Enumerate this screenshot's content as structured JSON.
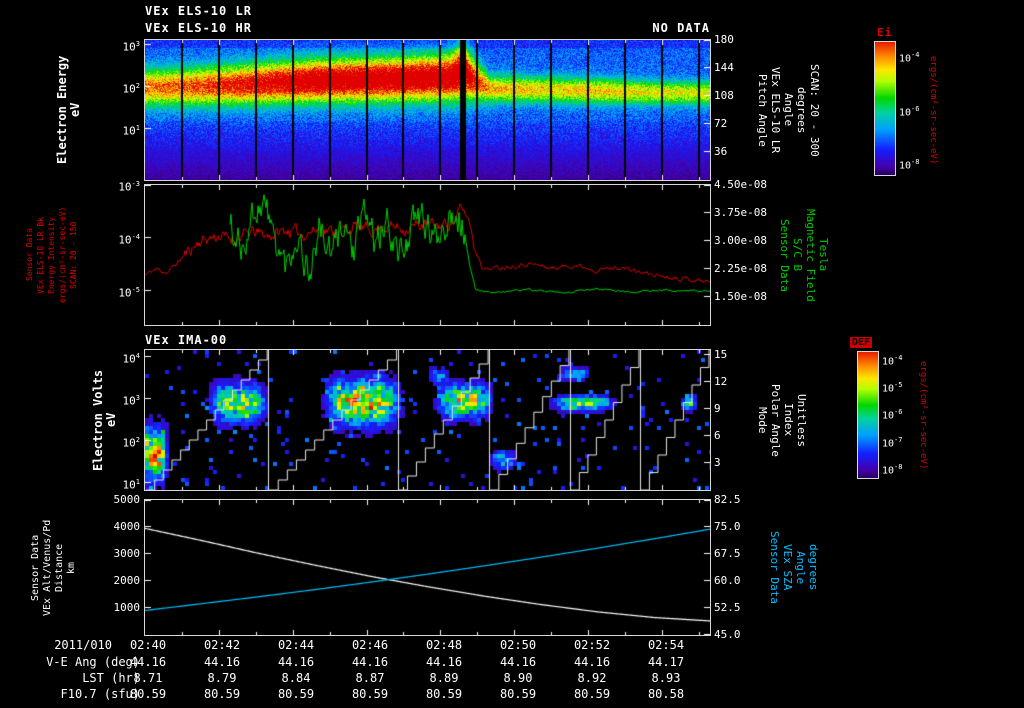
{
  "header": {
    "title1": "VEx ELS-10 LR",
    "title2": "VEx ELS-10 HR",
    "no_data": "NO DATA",
    "ima_title": "VEx IMA-00"
  },
  "colors": {
    "red": "#dd0000",
    "green": "#00cc00",
    "cyan": "#00bfff",
    "white": "#ffffff"
  },
  "colorbar1": {
    "title": "Ei",
    "units": "ergs/(cm²-sr-sec-eV)",
    "ticks": [
      "10^-4",
      "10^-6",
      "10^-8"
    ],
    "tick_fracs": [
      0.1,
      0.5,
      0.9
    ]
  },
  "colorbar2": {
    "title": "DEF",
    "units": "ergs/(cm²-sr-sec-eV)",
    "ticks": [
      "10^-4",
      "10^-5",
      "10^-6",
      "10^-7",
      "10^-8"
    ],
    "tick_fracs": [
      0.05,
      0.265,
      0.48,
      0.695,
      0.91
    ]
  },
  "footer": {
    "date": "2011/010",
    "time_ticks": [
      "02:40",
      "02:42",
      "02:44",
      "02:46",
      "02:48",
      "02:50",
      "02:52",
      "02:54"
    ],
    "rows": [
      {
        "label": "V-E Ang (deg)",
        "values": [
          "44.16",
          "44.16",
          "44.16",
          "44.16",
          "44.16",
          "44.16",
          "44.16",
          "44.17"
        ]
      },
      {
        "label": "LST (hr)",
        "values": [
          "8.71",
          "8.79",
          "8.84",
          "8.87",
          "8.89",
          "8.90",
          "8.92",
          "8.93"
        ]
      },
      {
        "label": "F10.7 (sfu)",
        "values": [
          "80.59",
          "80.59",
          "80.59",
          "80.59",
          "80.59",
          "80.59",
          "80.59",
          "80.58"
        ]
      }
    ]
  },
  "chart_data": [
    {
      "type": "heatmap",
      "title": "VEx ELS-10 LR",
      "subtitle": "VEx ELS-10 HR: NO DATA",
      "ylabel_lines": [
        "Electron Energy",
        "eV"
      ],
      "right_label_lines": [
        "Pitch Angle",
        "VEx ELS-10 LR",
        "Angle",
        "degrees",
        "SCAN: 20 - 300"
      ],
      "y_axis": {
        "scale": "log",
        "units": "eV",
        "log_range": [
          -0.21,
          3.12
        ],
        "ticks": [
          {
            "log": 3,
            "label": "10^3"
          },
          {
            "log": 2,
            "label": "10^2"
          },
          {
            "log": 1,
            "label": "10^1"
          }
        ]
      },
      "right_axis": {
        "units": "degrees",
        "range": [
          0,
          180
        ],
        "ticks": [
          180,
          144,
          108,
          72,
          36
        ]
      },
      "x_axis": {
        "date": "2011/010",
        "start": "02:40",
        "end": "02:55",
        "tick_interval_min": 2,
        "total_min": 15.3
      },
      "colorbar_label": "Ei",
      "band_track_format": [
        "time_frac",
        "log10_center_eV",
        "log10_width",
        "intensity"
      ],
      "band_track": [
        [
          0.0,
          2.0,
          0.42,
          0.68
        ],
        [
          0.08,
          2.02,
          0.44,
          0.72
        ],
        [
          0.18,
          2.08,
          0.46,
          0.85
        ],
        [
          0.3,
          2.16,
          0.48,
          1.0
        ],
        [
          0.45,
          2.2,
          0.5,
          1.0
        ],
        [
          0.54,
          2.24,
          0.52,
          1.0
        ],
        [
          0.562,
          2.38,
          0.62,
          1.05
        ],
        [
          0.585,
          2.15,
          0.45,
          0.8
        ],
        [
          0.61,
          1.97,
          0.32,
          0.6
        ],
        [
          0.7,
          1.95,
          0.3,
          0.56
        ],
        [
          0.8,
          1.92,
          0.3,
          0.58
        ],
        [
          0.9,
          1.88,
          0.28,
          0.52
        ],
        [
          1.0,
          1.86,
          0.28,
          0.5
        ]
      ],
      "data_gap_every_min": 1,
      "transition_gap_frac": 0.563,
      "note": "intense red electron flux band ~100-300 eV from 02:42 to 02:48.5, abrupt drop to weaker green band afterwards"
    },
    {
      "type": "line",
      "ylabel_lines": [
        "Sensor Data",
        "VEx ELS-10 LR Bk",
        "Energy Intensity",
        "ergs/(cm²-sr-sec-eV)",
        "SCAN: 20 - 150"
      ],
      "right_label_lines": [
        "Sensor Data",
        "S/C B",
        "Magnetic Field",
        "Tesla"
      ],
      "left_axis": {
        "scale": "log",
        "units": "ergs/(cm2-sr-sec-eV)",
        "log_range": [
          -5.64,
          -3.0
        ],
        "ticks": [
          {
            "log": -3,
            "label": "10^-3"
          },
          {
            "log": -4,
            "label": "10^-4"
          },
          {
            "log": -5,
            "label": "10^-5"
          }
        ]
      },
      "right_axis": {
        "scale": "linear",
        "units": "Tesla",
        "range": [
          7.5e-09,
          4.5e-08
        ],
        "ticks": [
          {
            "v": 4.5e-08,
            "label": "4.50e-08"
          },
          {
            "v": 3.75e-08,
            "label": "3.75e-08"
          },
          {
            "v": 3e-08,
            "label": "3.00e-08"
          },
          {
            "v": 2.25e-08,
            "label": "2.25e-08"
          },
          {
            "v": 1.5e-08,
            "label": "1.50e-08"
          }
        ]
      },
      "series": [
        {
          "name": "ELS-10 LR Bk energy intensity",
          "color": "#dd0000",
          "axis": "left",
          "start_frac": 0.0,
          "points": [
            [
              0.0,
              2e-05
            ],
            [
              0.02,
              2.6e-05
            ],
            [
              0.04,
              2.2e-05
            ],
            [
              0.06,
              3.6e-05
            ],
            [
              0.08,
              6e-05
            ],
            [
              0.1,
              9e-05
            ],
            [
              0.13,
              0.00011
            ],
            [
              0.16,
              9.5e-05
            ],
            [
              0.19,
              0.00013
            ],
            [
              0.22,
              0.00011
            ],
            [
              0.25,
              0.00014
            ],
            [
              0.28,
              0.00012
            ],
            [
              0.31,
              0.00015
            ],
            [
              0.34,
              0.00013
            ],
            [
              0.37,
              0.00016
            ],
            [
              0.4,
              0.00014
            ],
            [
              0.43,
              0.00017
            ],
            [
              0.46,
              0.00015
            ],
            [
              0.49,
              0.00018
            ],
            [
              0.52,
              0.00017
            ],
            [
              0.55,
              0.00021
            ],
            [
              0.558,
              0.00039
            ],
            [
              0.572,
              0.00023
            ],
            [
              0.583,
              6e-05
            ],
            [
              0.6,
              2.6e-05
            ],
            [
              0.64,
              2.9e-05
            ],
            [
              0.68,
              3.3e-05
            ],
            [
              0.72,
              2.7e-05
            ],
            [
              0.76,
              3.1e-05
            ],
            [
              0.8,
              2.5e-05
            ],
            [
              0.84,
              2.8e-05
            ],
            [
              0.88,
              2.2e-05
            ],
            [
              0.92,
              1.9e-05
            ],
            [
              0.96,
              1.7e-05
            ],
            [
              1.0,
              1.5e-05
            ]
          ]
        },
        {
          "name": "S/C B magnetic field magnitude",
          "color": "#00cc00",
          "axis": "right",
          "start_frac": 0.15,
          "points": [
            [
              0.15,
              3.4e-08
            ],
            [
              0.17,
              2.8e-08
            ],
            [
              0.19,
              3.7e-08
            ],
            [
              0.21,
              4.1e-08
            ],
            [
              0.23,
              3e-08
            ],
            [
              0.25,
              2.3e-08
            ],
            [
              0.27,
              3.2e-08
            ],
            [
              0.29,
              2.1e-08
            ],
            [
              0.31,
              3.4e-08
            ],
            [
              0.33,
              2.5e-08
            ],
            [
              0.35,
              3.6e-08
            ],
            [
              0.37,
              2.7e-08
            ],
            [
              0.39,
              3.8e-08
            ],
            [
              0.41,
              2.9e-08
            ],
            [
              0.43,
              3.5e-08
            ],
            [
              0.45,
              2.6e-08
            ],
            [
              0.47,
              3.3e-08
            ],
            [
              0.49,
              3.7e-08
            ],
            [
              0.51,
              3e-08
            ],
            [
              0.53,
              3.5e-08
            ],
            [
              0.55,
              3.9e-08
            ],
            [
              0.565,
              3.3e-08
            ],
            [
              0.575,
              2.3e-08
            ],
            [
              0.585,
              1.7e-08
            ],
            [
              0.62,
              1.62e-08
            ],
            [
              0.68,
              1.7e-08
            ],
            [
              0.74,
              1.6e-08
            ],
            [
              0.8,
              1.72e-08
            ],
            [
              0.86,
              1.63e-08
            ],
            [
              0.92,
              1.69e-08
            ],
            [
              1.0,
              1.65e-08
            ]
          ]
        }
      ]
    },
    {
      "type": "heatmap",
      "title": "VEx IMA-00",
      "ylabel_lines": [
        "Electron Volts",
        "eV"
      ],
      "right_label_lines": [
        "Mode",
        "Polar Angle",
        "Index",
        "Unitless"
      ],
      "y_axis": {
        "scale": "log",
        "units": "eV",
        "log_range": [
          0.83,
          4.17
        ],
        "ticks": [
          {
            "log": 4,
            "label": "10^4"
          },
          {
            "log": 3,
            "label": "10^3"
          },
          {
            "log": 2,
            "label": "10^2"
          },
          {
            "log": 1,
            "label": "10^1"
          }
        ]
      },
      "right_axis": {
        "units": "unitless",
        "range": [
          0,
          15.5
        ],
        "ticks": [
          15,
          12,
          9,
          6,
          3
        ]
      },
      "colorbar_label": "DEF",
      "blobs_format": [
        "t_center_frac",
        "t_halfwidth",
        "log10_center_eV",
        "log10_halfwidth",
        "amplitude"
      ],
      "blobs": [
        [
          0.015,
          0.022,
          1.7,
          0.55,
          0.95
        ],
        [
          0.165,
          0.045,
          2.9,
          0.4,
          0.8
        ],
        [
          0.385,
          0.058,
          2.92,
          0.48,
          1.0
        ],
        [
          0.565,
          0.042,
          2.95,
          0.35,
          0.85
        ],
        [
          0.635,
          0.02,
          1.55,
          0.2,
          0.45
        ],
        [
          0.52,
          0.015,
          3.55,
          0.18,
          0.32
        ],
        [
          0.775,
          0.048,
          2.9,
          0.16,
          0.7
        ],
        [
          0.76,
          0.025,
          3.6,
          0.14,
          0.33
        ],
        [
          0.965,
          0.012,
          2.9,
          0.16,
          0.6
        ]
      ],
      "scan_boundaries": [
        0,
        0.218,
        0.447,
        0.609,
        0.752,
        0.876,
        1.0
      ],
      "note": "sparse ion flux blobs near 1 keV; white stepped diagonal lines show elevation scan pattern"
    },
    {
      "type": "line",
      "ylabel_lines": [
        "Sensor Data",
        "VEx Alt/Venus/Pd",
        "Distance",
        "km"
      ],
      "right_label_lines": [
        "Sensor Data",
        "VEx SZA",
        "Angle",
        "degrees"
      ],
      "left_axis": {
        "scale": "linear",
        "units": "km",
        "range": [
          0,
          5000
        ],
        "ticks": [
          5000,
          4000,
          3000,
          2000,
          1000
        ]
      },
      "right_axis": {
        "scale": "linear",
        "units": "degrees",
        "range": [
          45.0,
          82.5
        ],
        "ticks": [
          82.5,
          75.0,
          67.5,
          60.0,
          52.5,
          45.0
        ]
      },
      "series": [
        {
          "name": "VEx altitude above Venus",
          "color": "#ffffff",
          "axis": "left",
          "points": [
            [
              0,
              3950
            ],
            [
              0.1,
              3500
            ],
            [
              0.2,
              3030
            ],
            [
              0.3,
              2590
            ],
            [
              0.4,
              2170
            ],
            [
              0.5,
              1790
            ],
            [
              0.6,
              1440
            ],
            [
              0.7,
              1130
            ],
            [
              0.8,
              860
            ],
            [
              0.9,
              650
            ],
            [
              1.0,
              520
            ]
          ]
        },
        {
          "name": "VEx solar zenith angle",
          "color": "#00bfff",
          "axis": "right",
          "points": [
            [
              0,
              51.8
            ],
            [
              0.1,
              53.7
            ],
            [
              0.2,
              55.6
            ],
            [
              0.3,
              57.6
            ],
            [
              0.4,
              59.7
            ],
            [
              0.5,
              61.9
            ],
            [
              0.6,
              64.2
            ],
            [
              0.7,
              66.6
            ],
            [
              0.8,
              69.1
            ],
            [
              0.9,
              71.7
            ],
            [
              1.0,
              74.4
            ]
          ]
        }
      ]
    }
  ]
}
